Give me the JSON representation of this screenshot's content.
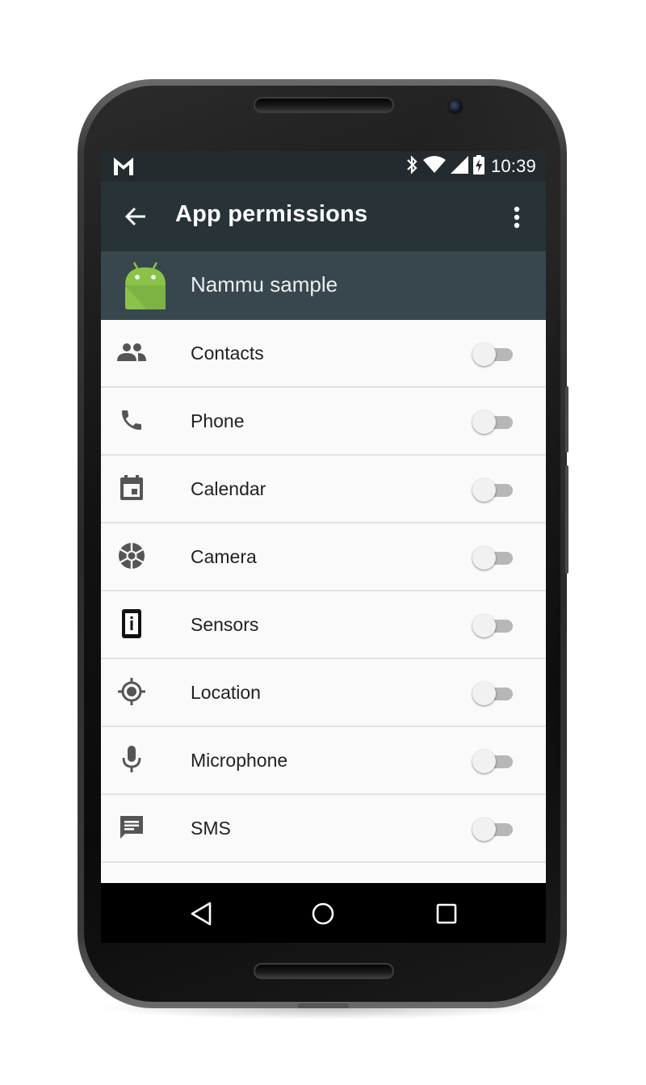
{
  "status_bar": {
    "time": "10:39",
    "icons": [
      "gmail-icon",
      "bluetooth-icon",
      "wifi-icon",
      "cell-signal-icon",
      "battery-charging-icon"
    ]
  },
  "app_bar": {
    "title": "App permissions",
    "back_icon": "arrow-back-icon",
    "menu_icon": "more-vert-icon"
  },
  "app_header": {
    "app_name": "Nammu sample",
    "app_icon": "android-robot-icon"
  },
  "permissions": [
    {
      "label": "Contacts",
      "icon": "contacts-icon",
      "enabled": false
    },
    {
      "label": "Phone",
      "icon": "phone-icon",
      "enabled": false
    },
    {
      "label": "Calendar",
      "icon": "calendar-icon",
      "enabled": false
    },
    {
      "label": "Camera",
      "icon": "camera-icon",
      "enabled": false
    },
    {
      "label": "Sensors",
      "icon": "sensors-icon",
      "enabled": false
    },
    {
      "label": "Location",
      "icon": "location-icon",
      "enabled": false
    },
    {
      "label": "Microphone",
      "icon": "microphone-icon",
      "enabled": false
    },
    {
      "label": "SMS",
      "icon": "sms-icon",
      "enabled": false
    }
  ],
  "nav_bar": {
    "buttons": [
      "nav-back-icon",
      "nav-home-icon",
      "nav-recents-icon"
    ]
  },
  "colors": {
    "status_bar": "#232b2f",
    "app_bar": "#283338",
    "app_header": "#38474d",
    "list_background": "#fafafa",
    "android_green": "#8bc34a"
  }
}
